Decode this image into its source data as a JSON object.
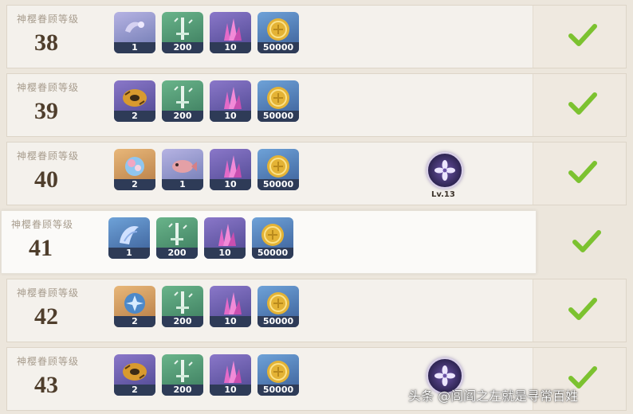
{
  "rows": [
    {
      "label": "神樱眷顾等级",
      "level": "38",
      "items": [
        {
          "icon": "lavender-ribbon-icon",
          "qty": "1"
        },
        {
          "icon": "green-sword-icon",
          "qty": "200"
        },
        {
          "icon": "pink-crystal-icon",
          "qty": "10"
        },
        {
          "icon": "mora-coin-icon",
          "qty": "50000"
        }
      ]
    },
    {
      "label": "神樱眷顾等级",
      "level": "39",
      "items": [
        {
          "icon": "tsuba-guard-icon",
          "qty": "2"
        },
        {
          "icon": "green-sword-icon",
          "qty": "200"
        },
        {
          "icon": "pink-crystal-icon",
          "qty": "10"
        },
        {
          "icon": "mora-coin-icon",
          "qty": "50000"
        }
      ]
    },
    {
      "label": "神樱眷顾等级",
      "level": "40",
      "items": [
        {
          "icon": "bloom-orb-icon",
          "qty": "2"
        },
        {
          "icon": "pink-fish-icon",
          "qty": "1"
        },
        {
          "icon": "pink-crystal-icon",
          "qty": "10"
        },
        {
          "icon": "mora-coin-icon",
          "qty": "50000"
        }
      ],
      "skill": {
        "level_label": "Lv.13"
      }
    },
    {
      "label": "神樱眷顾等级",
      "level": "41",
      "items": [
        {
          "icon": "blue-wing-icon",
          "qty": "1"
        },
        {
          "icon": "green-sword-icon",
          "qty": "200"
        },
        {
          "icon": "pink-crystal-icon",
          "qty": "10"
        },
        {
          "icon": "mora-coin-icon",
          "qty": "50000"
        }
      ]
    },
    {
      "label": "神樱眷顾等级",
      "level": "42",
      "items": [
        {
          "icon": "blue-gem-icon",
          "qty": "2"
        },
        {
          "icon": "green-sword-icon",
          "qty": "200"
        },
        {
          "icon": "pink-crystal-icon",
          "qty": "10"
        },
        {
          "icon": "mora-coin-icon",
          "qty": "50000"
        }
      ]
    },
    {
      "label": "神樱眷顾等级",
      "level": "43",
      "items": [
        {
          "icon": "tsuba-guard-icon",
          "qty": "2"
        },
        {
          "icon": "green-sword-icon",
          "qty": "200"
        },
        {
          "icon": "pink-crystal-icon",
          "qty": "10"
        },
        {
          "icon": "mora-coin-icon",
          "qty": "50000"
        }
      ],
      "skill": {
        "level_label": ""
      }
    }
  ],
  "status_icon": "checkmark-icon",
  "watermark": "头条 @闾阎之左就是寻常百姓",
  "colors": {
    "check_green": "#7cc230",
    "level_text": "#4f3e2c",
    "label_text": "#a79c8d",
    "row_bg": "#f4f1ec",
    "page_bg": "#ece6dc"
  }
}
